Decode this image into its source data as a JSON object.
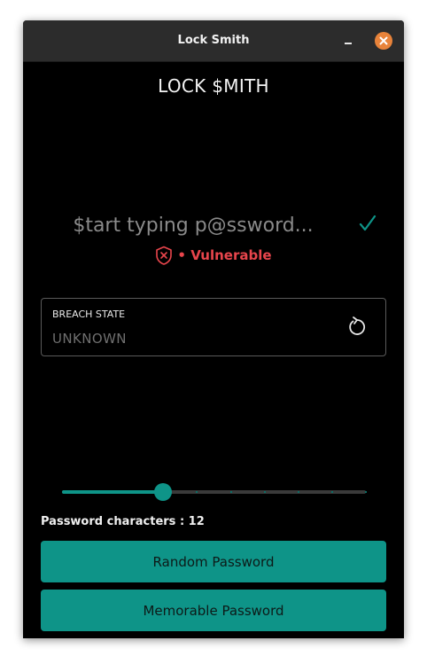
{
  "window": {
    "title": "Lock Smith",
    "close_color": "#e8833a"
  },
  "app": {
    "heading": "LOCK $MITH"
  },
  "password": {
    "placeholder": "$tart typing p@ssword...",
    "value": "",
    "strength_text": "• Vulnerable",
    "strength_color": "#e8454c",
    "check_icon": "checkmark-icon",
    "strength_icon": "shield-x-icon"
  },
  "breach": {
    "label": "BREACH STATE",
    "value": "UNKNOWN",
    "refresh_icon": "refresh-icon"
  },
  "length": {
    "label": "Password characters : 12",
    "value": 12,
    "min": 6,
    "max": 24,
    "accent": "#0e9488"
  },
  "buttons": {
    "random": "Random Password",
    "memorable": "Memorable Password"
  }
}
